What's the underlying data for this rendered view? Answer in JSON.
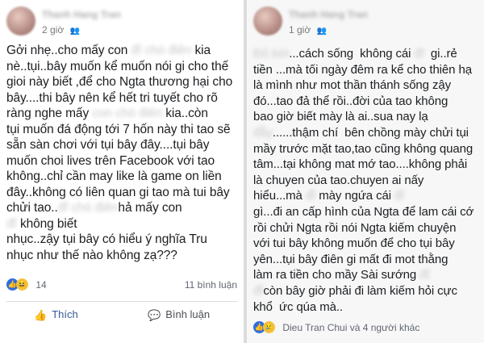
{
  "left_post": {
    "author": "Thanh Hang Tran",
    "time": "2 giờ",
    "text_parts": [
      "Gởi nhẹ..cho mấy con ",
      "đĩ chó điên",
      " kia\nnè..tụi..bây muốn kể muốn nói gi cho thế\ngioi này biết ,để cho Ngta thương hại cho\nbây....thi bây nên kể hết tri tuyết cho rõ\nràng nghe mấy ",
      "con chó điên",
      " kia..còn\ntụi muốn đá động tới 7 hốn này thi tao sẽ\nsẵn sàn chơi với tụi bây đây....tụi bây\nmuốn choi lives trên Facebook với tao\nkhông..chỉ cần may like là game on liền\nđây..không có liên quan gi tao mà tui bây\nchửi tao..",
      "đĩ chó điên",
      "hả mấy con\n",
      "đĩ",
      " không biết\nnhục..zậy tụi bây có hiểu ý nghĩa Tru\nnhục như thế nào không zạ???"
    ],
    "reaction_count": "14",
    "comments": "11 bình luận",
    "like_label": "Thích",
    "comment_label": "Bình luận"
  },
  "right_post": {
    "author": "Thanh Hang Tran",
    "time": "1 giờ",
    "text_parts": [
      "Đỏ bời",
      "...cách sống  không cái ",
      "đĩ",
      "  gi..rẻ\ntiền ...mà tối ngày đêm ra kể cho thiên hạ\nlà mình như mot thần thánh sống zậy\nđó...tao đả thể rồi..đời của tao không\nbao giờ biết mày là ai..sua nay lạ\n",
      "đẫy",
      "......thậm chí  bên chồng mày chửi tụi\nmầy trước mặt tao,tao cũng không quang\ntâm...tại không mat mớ tao....không phải\nlà chuyen của tao.chuyen ai nấy\nhiểu...mà ",
      "đĩ",
      " mày ngứa cái ",
      "đĩ",
      "\ngì...đi an cấp hình của Ngta để lam cái cớ\nrồi chửi Ngta rồi nói Ngta kiếm chuyện\nvới tui bây không muốn để cho tụi bây\nyên...tụi bây điên gi mất đi mot thằng\nlàm ra tiền cho mầy Sài sướng ",
      "đĩ",
      "\n",
      "đĩ",
      "còn bây giờ phải đi làm kiếm hỏi cực\nkhổ  ức qúa mà.."
    ],
    "reactions_text": "Dieu Tran Chui và 4 người khác"
  },
  "colors": {
    "like_blue": "#2f6de0",
    "link_blue": "#365899",
    "haha_yellow": "#f4c33d",
    "meta_gray": "#7a7a7a"
  },
  "icons": [
    "globe-icon",
    "like-icon",
    "haha-icon",
    "sad-icon",
    "thumbs-up-icon",
    "comment-bubble-icon"
  ]
}
